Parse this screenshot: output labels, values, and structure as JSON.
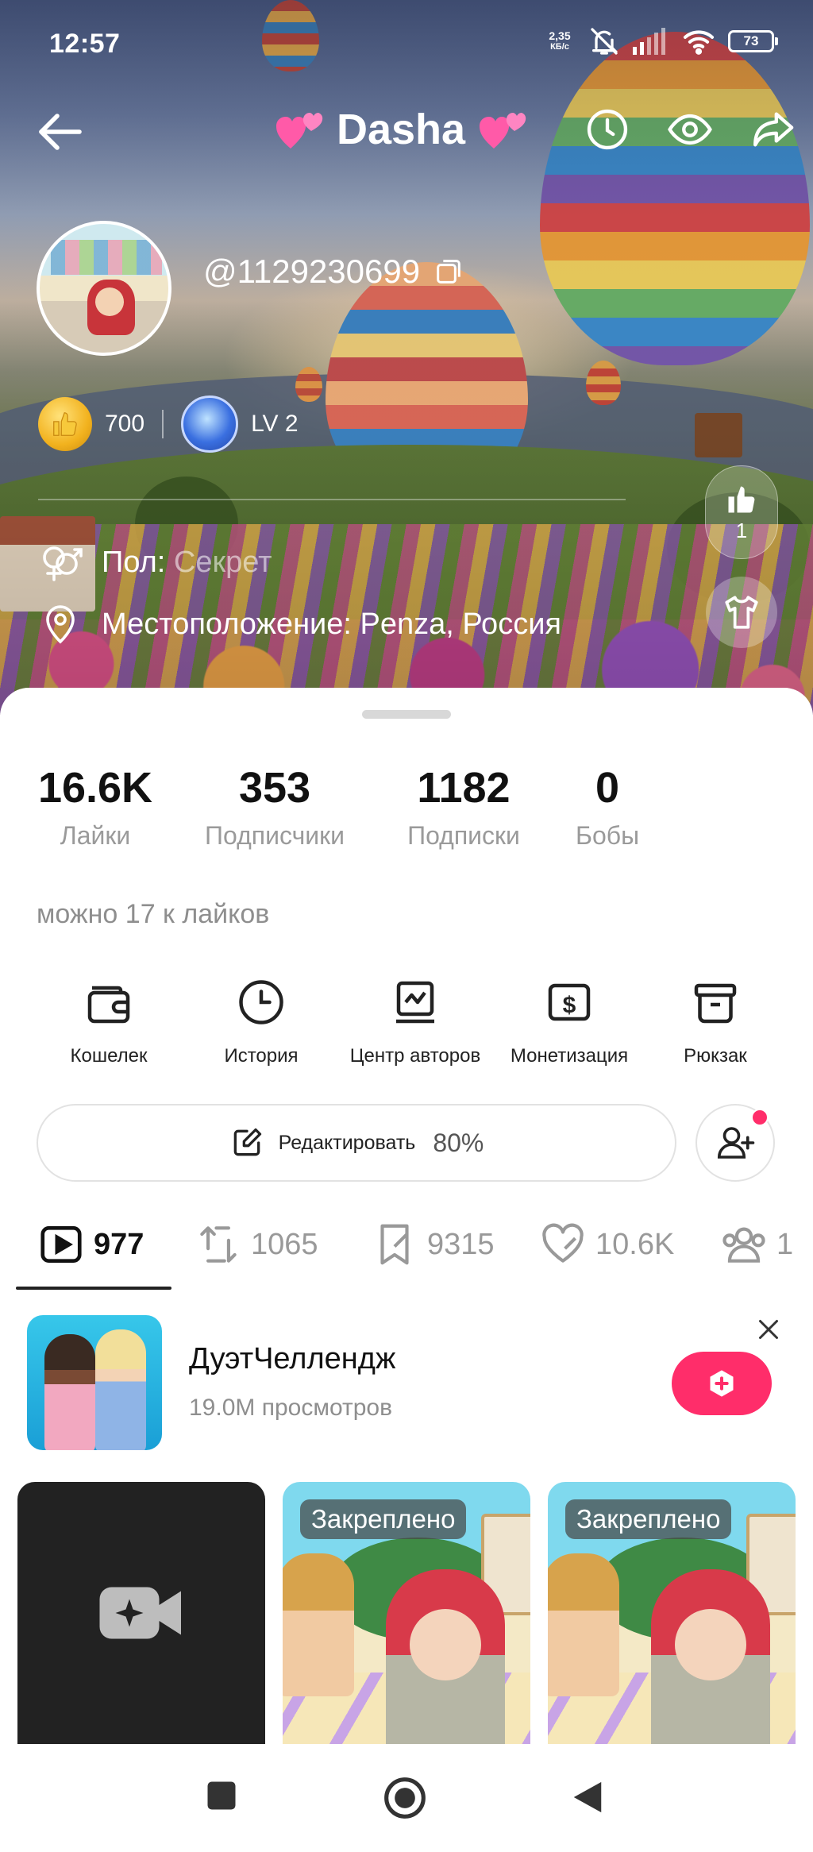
{
  "status_bar": {
    "time": "12:57",
    "net_speed_value": "2,35",
    "net_speed_unit": "КБ/с",
    "battery": "73"
  },
  "profile": {
    "display_name": "Dasha",
    "handle": "@1129230699",
    "coins": "700",
    "level": "LV 2",
    "gender_label": "Пол:",
    "gender_value": " Секрет",
    "location": "Местоположение: Penza, Россия",
    "likes_received": "1"
  },
  "stats": [
    {
      "value": "16.6K",
      "label": "Лайки"
    },
    {
      "value": "353",
      "label": "Подписчики"
    },
    {
      "value": "1182",
      "label": "Подписки"
    },
    {
      "value": "0",
      "label": "Бобы"
    }
  ],
  "hint": "можно 17 к лайков",
  "tools": [
    {
      "label": "Кошелек",
      "icon": "wallet-icon"
    },
    {
      "label": "История",
      "icon": "clock-icon"
    },
    {
      "label": "Центр авторов",
      "icon": "creator-center-icon"
    },
    {
      "label": "Монетизация",
      "icon": "dollar-icon"
    },
    {
      "label": "Рюкзак",
      "icon": "backpack-icon"
    }
  ],
  "edit": {
    "label": "Редактировать",
    "progress": "80%"
  },
  "content_tabs": [
    {
      "count": "977",
      "icon": "video-play-icon",
      "active": true
    },
    {
      "count": "1065",
      "icon": "repost-icon",
      "active": false
    },
    {
      "count": "9315",
      "icon": "bookmark-icon",
      "active": false
    },
    {
      "count": "10.6K",
      "icon": "heart-icon",
      "active": false
    },
    {
      "count": "1",
      "icon": "group-icon",
      "active": false
    }
  ],
  "promo": {
    "title": "ДуэтЧеллендж",
    "views": "19.0M просмотров"
  },
  "videos": {
    "pinned_label": "Закреплено"
  },
  "colors": {
    "accent": "#ff2d6a",
    "text_primary": "#111111",
    "text_muted": "#9a9a9a"
  }
}
